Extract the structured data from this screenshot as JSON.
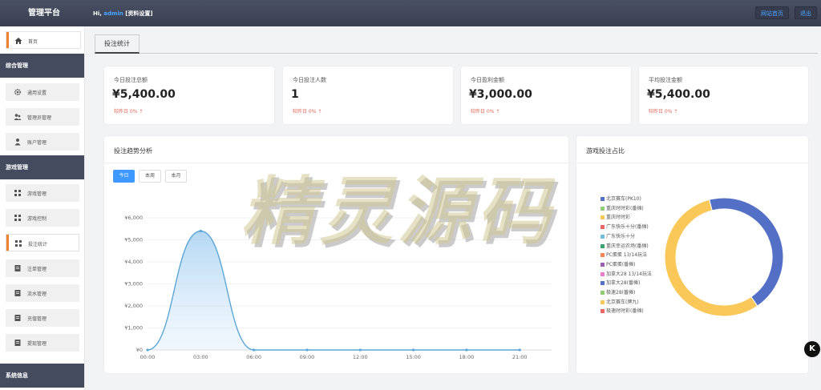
{
  "header": {
    "brand": "管理平台",
    "greeting_prefix": "Hi,",
    "username": "admin",
    "profile_link": "[资料设置]",
    "site_home": "网站首页",
    "logout": "退出"
  },
  "sidebar": {
    "home": "首页",
    "groups": [
      {
        "title": "综合管理",
        "items": [
          "通用设置",
          "管理员管理",
          "账户管理"
        ]
      },
      {
        "title": "游戏管理",
        "items": [
          "游戏管理",
          "游戏控制",
          "投注统计",
          "注单管理",
          "流水管理",
          "充值管理",
          "提现管理"
        ]
      },
      {
        "title": "系统信息",
        "items": []
      }
    ],
    "active_item": "投注统计"
  },
  "tab": {
    "label": "投注统计"
  },
  "stats": [
    {
      "label": "今日投注总额",
      "value": "¥5,400.00",
      "compare": "较昨日 0% ↑"
    },
    {
      "label": "今日投注人数",
      "value": "1",
      "compare": "较昨日 0% ↑"
    },
    {
      "label": "今日盈利金额",
      "value": "¥3,000.00",
      "compare": "较昨日 0% ↑"
    },
    {
      "label": "平均投注金额",
      "value": "¥5,400.00",
      "compare": "较昨日 0% ↑"
    }
  ],
  "trend": {
    "title": "投注趋势分析",
    "ranges": [
      "今日",
      "本周",
      "本月"
    ],
    "active_range": "今日"
  },
  "share": {
    "title": "游戏投注占比"
  },
  "watermark": "精灵源码",
  "corner_badge": "K",
  "colors": {
    "accent": "#3d98ff",
    "sidebar_active_bar": "#f0812f",
    "line": "#5aa6d6",
    "donut_yellow": "#f8c85a",
    "donut_blue": "#5470c6"
  },
  "chart_data": [
    {
      "type": "area",
      "title": "投注趋势分析",
      "x_ticks": [
        "00:00",
        "03:00",
        "06:00",
        "09:00",
        "12:00",
        "15:00",
        "18:00",
        "21:00"
      ],
      "y_ticks": [
        "¥0",
        "¥1,000",
        "¥2,000",
        "¥3,000",
        "¥4,000",
        "¥5,000",
        "¥6,000"
      ],
      "ylim": [
        0,
        6000
      ],
      "x_hours": [
        0,
        3,
        6,
        9,
        12,
        15,
        18,
        21
      ],
      "values": [
        0,
        5400,
        0,
        0,
        0,
        0,
        0,
        0
      ],
      "grid": true
    },
    {
      "type": "pie",
      "title": "游戏投注占比",
      "legend": [
        {
          "name": "北京赛车(PK10)",
          "color": "#5470c6"
        },
        {
          "name": "重庆时时彩(番摊)",
          "color": "#91cc75"
        },
        {
          "name": "重庆时时彩",
          "color": "#fac858"
        },
        {
          "name": "广东快乐十分(番摊)",
          "color": "#ee6666"
        },
        {
          "name": "广东快乐十分",
          "color": "#73c0de"
        },
        {
          "name": "重庆幸运农场(番摊)",
          "color": "#3ba272"
        },
        {
          "name": "PC蛋蛋 13/14玩法",
          "color": "#fc8452"
        },
        {
          "name": "PC蛋蛋(番摊)",
          "color": "#9a60b4"
        },
        {
          "name": "加拿大28 13/14玩法",
          "color": "#ea7ccc"
        },
        {
          "name": "加拿大28(番摊)",
          "color": "#5470c6"
        },
        {
          "name": "极速28(番摊)",
          "color": "#91cc75"
        },
        {
          "name": "北京赛车(牌九)",
          "color": "#fac858"
        },
        {
          "name": "极速时时彩(番摊)",
          "color": "#ee6666"
        }
      ],
      "slices": [
        {
          "name": "北京赛车(PK10)",
          "value": 2400,
          "color": "#5470c6"
        },
        {
          "name": "重庆时时彩",
          "value": 3000,
          "color": "#fac858"
        }
      ],
      "legend_position": "left"
    }
  ]
}
